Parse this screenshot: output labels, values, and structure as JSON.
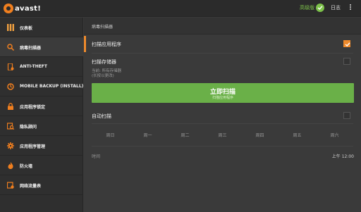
{
  "topbar": {
    "logo_text": "avast!",
    "premium_label": "高级版",
    "log_label": "日志"
  },
  "sidebar": {
    "items": [
      {
        "label": "仪表板",
        "icon": "dashboard-icon"
      },
      {
        "label": "病毒扫描器",
        "icon": "scan-icon",
        "active": true
      },
      {
        "label": "ANTI-THEFT",
        "icon": "anti-theft-icon"
      },
      {
        "label": "MOBILE BACKUP (INSTALL)",
        "icon": "backup-icon"
      },
      {
        "label": "应用程序锁定",
        "icon": "lock-icon"
      },
      {
        "label": "隐私顾问",
        "icon": "privacy-icon"
      },
      {
        "label": "应用程序管理",
        "icon": "gear-icon"
      },
      {
        "label": "防火墙",
        "icon": "firewall-icon"
      },
      {
        "label": "网络流量表",
        "icon": "traffic-icon"
      }
    ]
  },
  "main": {
    "title": "病毒扫描器",
    "scan_apps": {
      "label": "扫描应用程序",
      "checked": true
    },
    "scan_storage": {
      "label": "扫描存储器",
      "checked": false,
      "sub1": "当前: 所有存储器",
      "sub2": "(长按以更改)"
    },
    "scan_button": {
      "label": "立即扫描",
      "sub": "扫描应用程序"
    },
    "auto_scan": {
      "label": "自动扫描",
      "checked": false
    },
    "days": [
      "周日",
      "周一",
      "周二",
      "周三",
      "周四",
      "周五",
      "周六"
    ],
    "time_label": "时间",
    "time_value": "上午 12:00"
  },
  "colors": {
    "accent_orange": "#ee8a2c",
    "accent_green": "#6ab048",
    "premium_green": "#7dc24a"
  }
}
